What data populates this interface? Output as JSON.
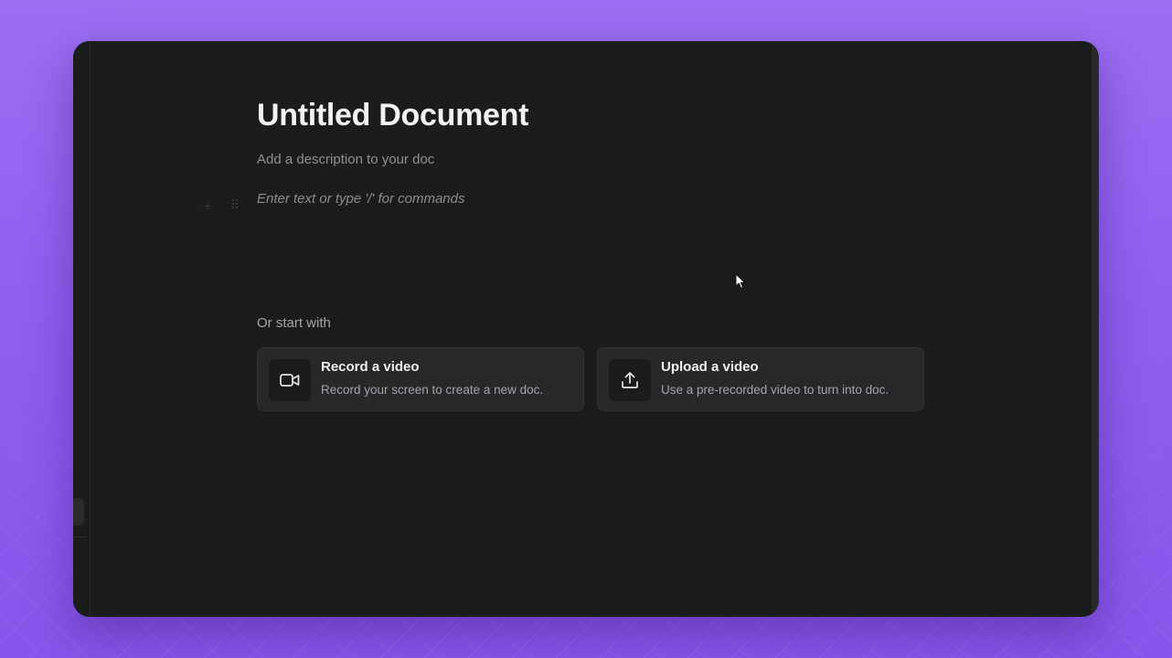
{
  "document": {
    "title": "Untitled Document",
    "description_placeholder": "Add a description to your doc",
    "editor_placeholder": "Enter text or type '/' for commands"
  },
  "block_controls": {
    "add_icon": "plus-icon",
    "drag_icon": "drag-handle-icon",
    "add_glyph": "+",
    "drag_glyph": "⠿"
  },
  "start_section": {
    "label": "Or start with",
    "cards": [
      {
        "icon": "video-camera-icon",
        "title": "Record a video",
        "subtitle": "Record your screen to create a new doc."
      },
      {
        "icon": "upload-icon",
        "title": "Upload a video",
        "subtitle": "Use a pre-recorded video to turn into doc."
      }
    ]
  },
  "colors": {
    "window_background": "#1b1c1c",
    "card_background": "#27282a",
    "page_background": "#9b6ff2"
  }
}
